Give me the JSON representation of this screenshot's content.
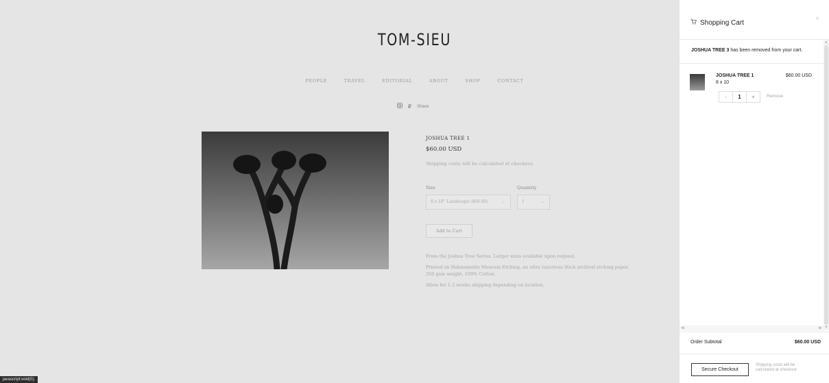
{
  "site": {
    "logo": "TOM-SIEU",
    "nav": [
      "PEOPLE",
      "TRAVEL",
      "EDITORIAL",
      "ABOUT",
      "SHOP",
      "CONTACT"
    ],
    "share_label": "Share"
  },
  "product": {
    "title": "JOSHUA TREE 1",
    "price": "$60.00 USD",
    "shipping_note": "Shipping costs will be calculated at checkout.",
    "size_label": "Size",
    "quantity_label": "Quantity",
    "size_value": "8 x 10\" Landscape ($60.00)",
    "quantity_value": "1",
    "add_to_cart": "Add to Cart",
    "description": [
      "From the Joshua Tree Series. Larger sizes available upon request.",
      "Printed on Hahnemuhle Museum Etching, an ultra luxurious thick archival etching paper. 350 gsm weight. 100% Cotton.",
      "Allow for 1-2 weeks shipping depending on location."
    ]
  },
  "status_bar": "javascript:void(0);",
  "cart": {
    "title": "Shopping Cart",
    "close": "×",
    "notice_item": "JOSHUA TREE 3",
    "notice_text": " has been removed from your cart.",
    "item": {
      "name": "JOSHUA TREE 1",
      "size": "8 x 10",
      "price": "$60.00 USD",
      "qty": "1",
      "minus": "-",
      "plus": "+",
      "remove": "Remove"
    },
    "subtotal_label": "Order Subtotal",
    "subtotal_value": "$60.00 USD",
    "checkout": "Secure Checkout",
    "checkout_note": "Shipping costs will be calculated at checkout."
  },
  "icons": {
    "instagram": "instagram-icon",
    "pinterest": "pinterest-icon",
    "cart": "cart-icon",
    "close": "close-icon",
    "chevron": "chevron-down-icon"
  }
}
